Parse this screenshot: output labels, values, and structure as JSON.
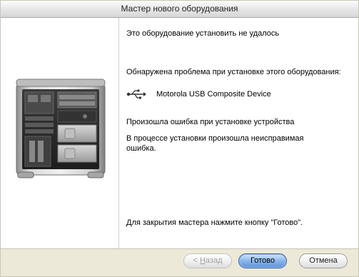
{
  "window": {
    "title": "Мастер нового оборудования"
  },
  "content": {
    "heading": "Это оборудование установить не удалось",
    "problem_text": "Обнаружена проблема при установке этого оборудования:",
    "device_icon": "usb-icon",
    "device_name": "Motorola USB Composite Device",
    "error_title": "Произошла ошибка при установке устройства",
    "error_detail_line1": "В процессе установки произошла неисправимая",
    "error_detail_line2": "ошибка.",
    "finish_hint": "Для закрытия мастера нажмите кнопку \"Готово\"."
  },
  "footer": {
    "back_prefix": "< ",
    "back_hotkey": "Н",
    "back_rest": "азад",
    "back_enabled": false,
    "finish_label": "Готово",
    "cancel_label": "Отмена"
  },
  "illustration": {
    "icon": "computer-tower-icon"
  }
}
